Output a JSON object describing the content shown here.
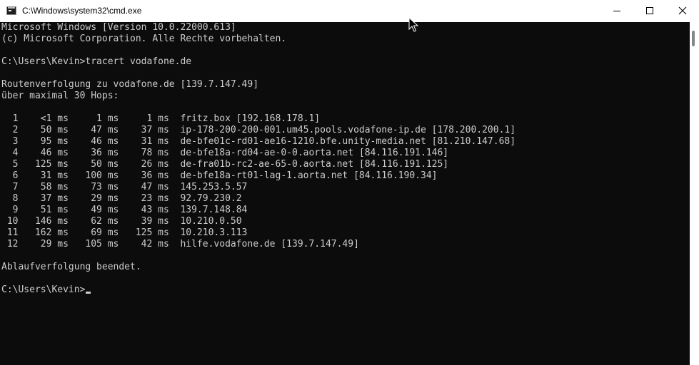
{
  "window": {
    "title": "C:\\Windows\\system32\\cmd.exe",
    "icon": "cmd-icon"
  },
  "caption_buttons": {
    "minimize_icon": "minimize-icon",
    "maximize_icon": "maximize-icon",
    "close_icon": "close-icon"
  },
  "console": {
    "lines": [
      "Microsoft Windows [Version 10.0.22000.613]",
      "(c) Microsoft Corporation. Alle Rechte vorbehalten.",
      "",
      "C:\\Users\\Kevin>tracert vodafone.de",
      "",
      "Routenverfolgung zu vodafone.de [139.7.147.49]",
      "über maximal 30 Hops:",
      "",
      "  1    <1 ms     1 ms     1 ms  fritz.box [192.168.178.1]",
      "  2    50 ms    47 ms    37 ms  ip-178-200-200-001.um45.pools.vodafone-ip.de [178.200.200.1]",
      "  3    95 ms    46 ms    31 ms  de-bfe01c-rd01-ae16-1210.bfe.unity-media.net [81.210.147.68]",
      "  4    46 ms    36 ms    78 ms  de-bfe18a-rd04-ae-0-0.aorta.net [84.116.191.146]",
      "  5   125 ms    50 ms    26 ms  de-fra01b-rc2-ae-65-0.aorta.net [84.116.191.125]",
      "  6    31 ms   100 ms    36 ms  de-bfe18a-rt01-lag-1.aorta.net [84.116.190.34]",
      "  7    58 ms    73 ms    47 ms  145.253.5.57",
      "  8    37 ms    29 ms    23 ms  92.79.230.2",
      "  9    51 ms    49 ms    43 ms  139.7.148.84",
      " 10   146 ms    62 ms    39 ms  10.210.0.50",
      " 11   162 ms    69 ms   125 ms  10.210.3.113",
      " 12    29 ms   105 ms    42 ms  hilfe.vodafone.de [139.7.147.49]",
      "",
      "Ablaufverfolgung beendet.",
      ""
    ],
    "prompt": "C:\\Users\\Kevin>"
  },
  "colors": {
    "console_background": "#0c0c0c",
    "console_text": "#cccccc",
    "titlebar_background": "#ffffff"
  }
}
